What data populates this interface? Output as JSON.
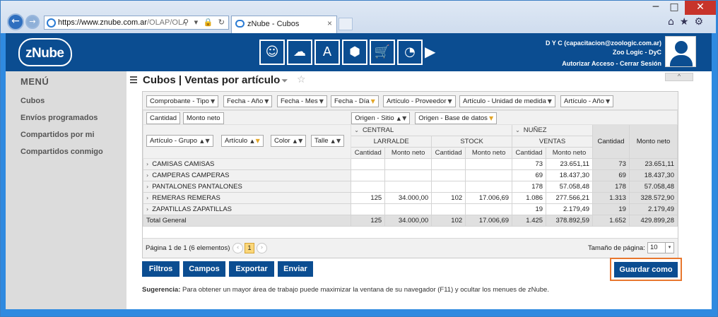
{
  "browser": {
    "url_main": "https://www.znube.com.ar",
    "url_rest": "/OLAP/OLAP?idRepor",
    "tab_title": "zNube - Cubos",
    "tab_close": "×",
    "addr_tools": "⚲ ▾ 🔒 ↻",
    "right_icons": "⌂★⚙",
    "win_min": "─",
    "win_max": "□",
    "win_close": "✕",
    "back_glyph": "←",
    "fwd_glyph": "→"
  },
  "header": {
    "logo": "zNube",
    "nav_icons": [
      "user-cycle-icon",
      "cloud-icon",
      "text-scale-icon",
      "cube-icon",
      "cart-icon",
      "clock-icon"
    ],
    "nav_glyphs": [
      "☺",
      "☁",
      "A",
      "⬢",
      "🛒",
      "◔"
    ],
    "more_glyph": "▶",
    "user_line1": "D Y C (capacitacion@zoologic.com.ar)",
    "user_line2": "Zoo Logic - DyC",
    "authorize": "Autorizar Acceso",
    "separator": " - ",
    "logout": "Cerrar Sesión"
  },
  "sidebar": {
    "title": "MENÚ",
    "items": [
      {
        "label": "Cubos"
      },
      {
        "label": "Envíos programados"
      },
      {
        "label": "Compartidos por mi"
      },
      {
        "label": "Compartidos conmigo"
      }
    ]
  },
  "main": {
    "title": "Cubos | Ventas por artículo",
    "collapse_glyph": "^",
    "filter_glyph": "⏷",
    "star_glyph": "☆"
  },
  "pivot": {
    "filter_fields": [
      "Comprobante - Tipo",
      "Fecha - Año",
      "Fecha - Mes",
      "Fecha - Día",
      "Artículo - Proveedor",
      "Artículo - Unidad de medida",
      "Artículo - Año"
    ],
    "data_fields": [
      "Cantidad",
      "Monto neto"
    ],
    "column_fields": [
      "Origen - Sitio",
      "Origen - Base de datos"
    ],
    "row_fields": [
      "Artículo - Grupo",
      "Artículo",
      "Color",
      "Talle"
    ],
    "col_groups": [
      {
        "label": "CENTRAL",
        "children": [
          "LARRALDE",
          "STOCK"
        ]
      },
      {
        "label": "NUÑEZ",
        "children": [
          "VENTAS"
        ]
      }
    ],
    "measure_headers": [
      "Cantidad",
      "Monto neto",
      "Cantidad",
      "Monto neto",
      "Cantidad",
      "Monto neto"
    ],
    "grand_headers": [
      "Cantidad",
      "Monto neto"
    ],
    "rows": [
      {
        "label": "CAMISAS CAMISAS",
        "cells": [
          "",
          "",
          "",
          "",
          "73",
          "23.651,11",
          "73",
          "23.651,11"
        ]
      },
      {
        "label": "CAMPERAS CAMPERAS",
        "cells": [
          "",
          "",
          "",
          "",
          "69",
          "18.437,30",
          "69",
          "18.437,30"
        ]
      },
      {
        "label": "PANTALONES PANTALONES",
        "cells": [
          "",
          "",
          "",
          "",
          "178",
          "57.058,48",
          "178",
          "57.058,48"
        ]
      },
      {
        "label": "REMERAS REMERAS",
        "cells": [
          "125",
          "34.000,00",
          "102",
          "17.006,69",
          "1.086",
          "277.566,21",
          "1.313",
          "328.572,90"
        ]
      },
      {
        "label": "ZAPATILLAS ZAPATILLAS",
        "cells": [
          "",
          "",
          "",
          "",
          "19",
          "2.179,49",
          "19",
          "2.179,49"
        ]
      }
    ],
    "total": {
      "label": "Total General",
      "cells": [
        "125",
        "34.000,00",
        "102",
        "17.006,69",
        "1.425",
        "378.892,59",
        "1.652",
        "429.899,28"
      ]
    },
    "pager": {
      "info": "Página 1 de 1 (6 elementos)",
      "current": "1",
      "prev_glyph": "‹",
      "next_glyph": "›",
      "size_label": "Tamaño de página:",
      "size_value": "10",
      "dd_glyph": "▾"
    }
  },
  "actions": {
    "filtros": "Filtros",
    "campos": "Campos",
    "exportar": "Exportar",
    "enviar": "Enviar",
    "guardar": "Guardar como"
  },
  "hint": {
    "label": "Sugerencia:",
    "text": " Para obtener un mayor área de trabajo puede maximizar la ventana de su navegador (F11) y ocultar los menues de zNube."
  },
  "colors": {
    "brand": "#0b4d91",
    "highlight": "#e8772e",
    "filter_mark": "#e3a629"
  }
}
